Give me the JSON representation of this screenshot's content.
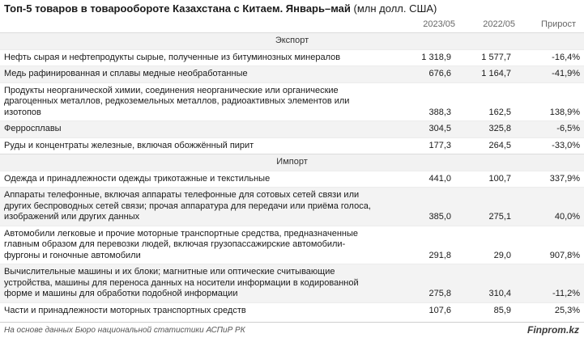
{
  "header": {
    "title_bold": "Топ-5 товаров в товарообороте Казахстана с Китаем. Январь–май",
    "title_unit": "(млн долл. США)",
    "col_2023": "2023/05",
    "col_2022": "2022/05",
    "col_growth": "Прирост"
  },
  "sections": {
    "export": "Экспорт",
    "import": "Импорт"
  },
  "export_rows": [
    {
      "name": "Нефть сырая и нефтепродукты сырые, полученные из битуминозных минералов",
      "v2023": "1 318,9",
      "v2022": "1 577,7",
      "growth": "-16,4%"
    },
    {
      "name": "Медь рафинированная и сплавы медные необработанные",
      "v2023": "676,6",
      "v2022": "1 164,7",
      "growth": "-41,9%"
    },
    {
      "name": "Продукты неорганической химии, соединения неорганические или органические драгоценных металлов, редкоземельных металлов, радиоактивных элементов или изотопов",
      "v2023": "388,3",
      "v2022": "162,5",
      "growth": "138,9%"
    },
    {
      "name": "Ферросплавы",
      "v2023": "304,5",
      "v2022": "325,8",
      "growth": "-6,5%"
    },
    {
      "name": "Руды и концентраты железные, включая обожжённый пирит",
      "v2023": "177,3",
      "v2022": "264,5",
      "growth": "-33,0%"
    }
  ],
  "import_rows": [
    {
      "name": "Одежда и принадлежности одежды трикотажные и текстильные",
      "v2023": "441,0",
      "v2022": "100,7",
      "growth": "337,9%"
    },
    {
      "name": "Аппараты телефонные, включая аппараты телефонные для сотовых сетей связи или других беспроводных сетей связи; прочая аппаратура для передачи или приёма голоса, изображений или других данных",
      "v2023": "385,0",
      "v2022": "275,1",
      "growth": "40,0%"
    },
    {
      "name": "Автомобили легковые и прочие моторные транспортные средства, предназначенные главным образом для перевозки людей, включая грузопассажирские автомобили-фургоны и гоночные автомобили",
      "v2023": "291,8",
      "v2022": "29,0",
      "growth": "907,8%"
    },
    {
      "name": "Вычислительные машины и их блоки; магнитные или оптические считывающие устройства, машины для переноса данных на носители информации в кодированной форме и машины для обработки подобной информации",
      "v2023": "275,8",
      "v2022": "310,4",
      "growth": "-11,2%"
    },
    {
      "name": "Части и принадлежности моторных транспортных средств",
      "v2023": "107,6",
      "v2022": "85,9",
      "growth": "25,3%"
    }
  ],
  "footer": {
    "source": "На основе данных Бюро национальной статистики АСПиР РК",
    "brand": "Finprom.kz"
  }
}
